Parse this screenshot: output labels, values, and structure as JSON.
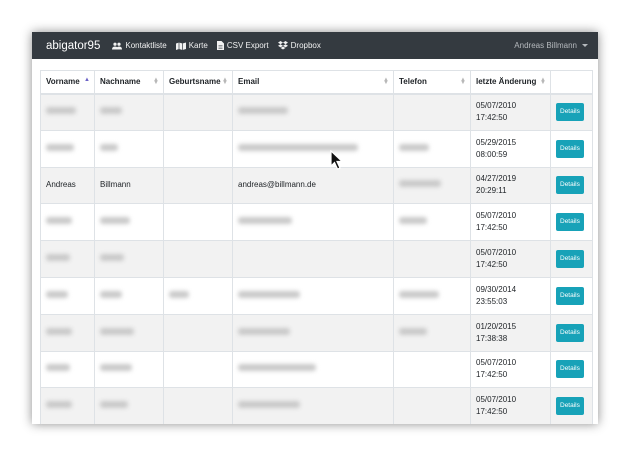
{
  "navbar": {
    "brand": "abigator95",
    "items": [
      {
        "label": "Kontaktliste",
        "icon": "users-icon"
      },
      {
        "label": "Karte",
        "icon": "map-icon"
      },
      {
        "label": "CSV Export",
        "icon": "file-icon"
      },
      {
        "label": "Dropbox",
        "icon": "dropbox-icon"
      }
    ],
    "user": "Andreas Billmann"
  },
  "table": {
    "headers": [
      "Vorname",
      "Nachname",
      "Geburtsname",
      "Email",
      "Telefon",
      "letzte Änderung",
      ""
    ],
    "details_label": "Details",
    "rows": [
      {
        "vorname": "",
        "nachname": "",
        "geburtsname": "",
        "email": "",
        "telefon": "",
        "date": "05/07/2010",
        "time": "17:42:50"
      },
      {
        "vorname": "",
        "nachname": "",
        "geburtsname": "",
        "email": "",
        "telefon": "",
        "date": "05/29/2015",
        "time": "08:00:59"
      },
      {
        "vorname": "Andreas",
        "nachname": "Billmann",
        "geburtsname": "",
        "email": "andreas@billmann.de",
        "telefon": "",
        "date": "04/27/2019",
        "time": "20:29:11"
      },
      {
        "vorname": "",
        "nachname": "",
        "geburtsname": "",
        "email": "",
        "telefon": "",
        "date": "05/07/2010",
        "time": "17:42:50"
      },
      {
        "vorname": "",
        "nachname": "",
        "geburtsname": "",
        "email": "",
        "telefon": "",
        "date": "05/07/2010",
        "time": "17:42:50"
      },
      {
        "vorname": "",
        "nachname": "",
        "geburtsname": "",
        "email": "",
        "telefon": "",
        "date": "09/30/2014",
        "time": "23:55:03"
      },
      {
        "vorname": "",
        "nachname": "",
        "geburtsname": "",
        "email": "",
        "telefon": "",
        "date": "01/20/2015",
        "time": "17:38:38"
      },
      {
        "vorname": "",
        "nachname": "",
        "geburtsname": "",
        "email": "",
        "telefon": "",
        "date": "05/07/2010",
        "time": "17:42:50"
      },
      {
        "vorname": "",
        "nachname": "",
        "geburtsname": "",
        "email": "",
        "telefon": "",
        "date": "05/07/2010",
        "time": "17:42:50"
      }
    ]
  },
  "colors": {
    "navbar": "#343a40",
    "details_button": "#17a2b8",
    "sort_active": "#6c63c7"
  }
}
